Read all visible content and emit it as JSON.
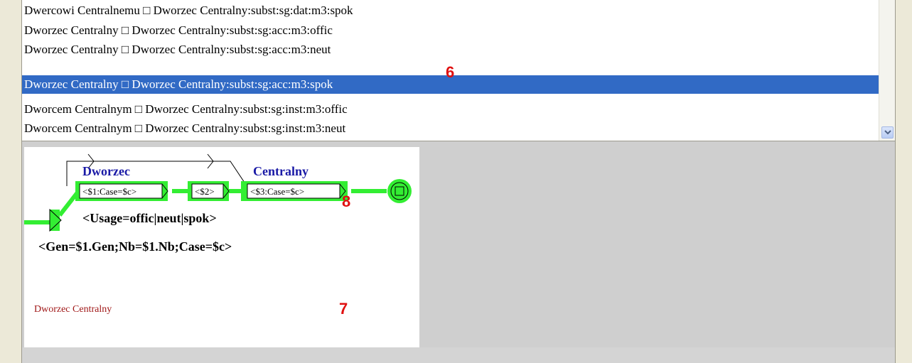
{
  "concordance": {
    "rows": [
      {
        "text": "Dwercowi Centralnemu □ Dworzec Centralny:subst:sg:dat:m3:spok",
        "selected": false
      },
      {
        "text": "Dworzec Centralny □ Dworzec Centralny:subst:sg:acc:m3:offic",
        "selected": false
      },
      {
        "text": "Dworzec Centralny □ Dworzec Centralny:subst:sg:acc:m3:neut",
        "selected": false
      },
      {
        "text": "Dworzec Centralny □ Dworzec Centralny:subst:sg:acc:m3:spok",
        "selected": true
      },
      {
        "text": "Dworcem Centralnym □ Dworzec Centralny:subst:sg:inst:m3:offic",
        "selected": false
      },
      {
        "text": "Dworcem Centralnym □ Dworzec Centralny:subst:sg:inst:m3:neut",
        "selected": false
      }
    ],
    "scroll_icon": "chevron-down-icon"
  },
  "graph": {
    "box_labels": {
      "dworzec": "Dworzec",
      "centralny": "Centralny"
    },
    "boxes": {
      "case1": "<$1:Case=$c>",
      "s2": "<$2>",
      "case3": "<$3:Case=$c>"
    },
    "usage_output": "<Usage=offic|neut|spok>",
    "gen_output": "<Gen=$1.Gen;Nb=$1.Nb;Case=$c>",
    "lemma_comment": "Dworzec Centralny",
    "colors": {
      "box_green": "#33ee33",
      "label_blue": "#1a1aa6",
      "comment_red": "#a01818",
      "selection": "#316ac5"
    }
  },
  "annotations": {
    "a6": "6",
    "a7": "7",
    "a8": "8"
  }
}
